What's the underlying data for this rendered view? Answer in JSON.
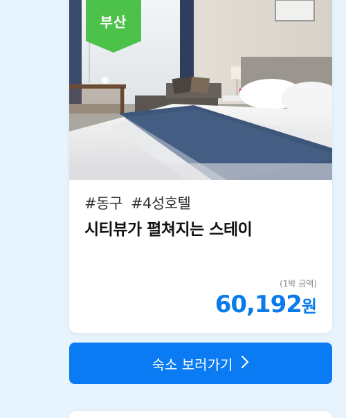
{
  "listing": {
    "region_badge": "부산",
    "tags": [
      "#동구",
      "#4성호텔"
    ],
    "title": "시티뷰가 펼쳐지는 스테이",
    "price_note": "(1박 금액)",
    "price_amount": "60,192",
    "price_unit": "원"
  },
  "cta": {
    "label": "숙소 보러가기",
    "icon": "chevron-right-icon"
  },
  "colors": {
    "background": "#e8f4fd",
    "badge": "#4cc24a",
    "price": "#0a7bea",
    "button": "#0a7bf2"
  }
}
